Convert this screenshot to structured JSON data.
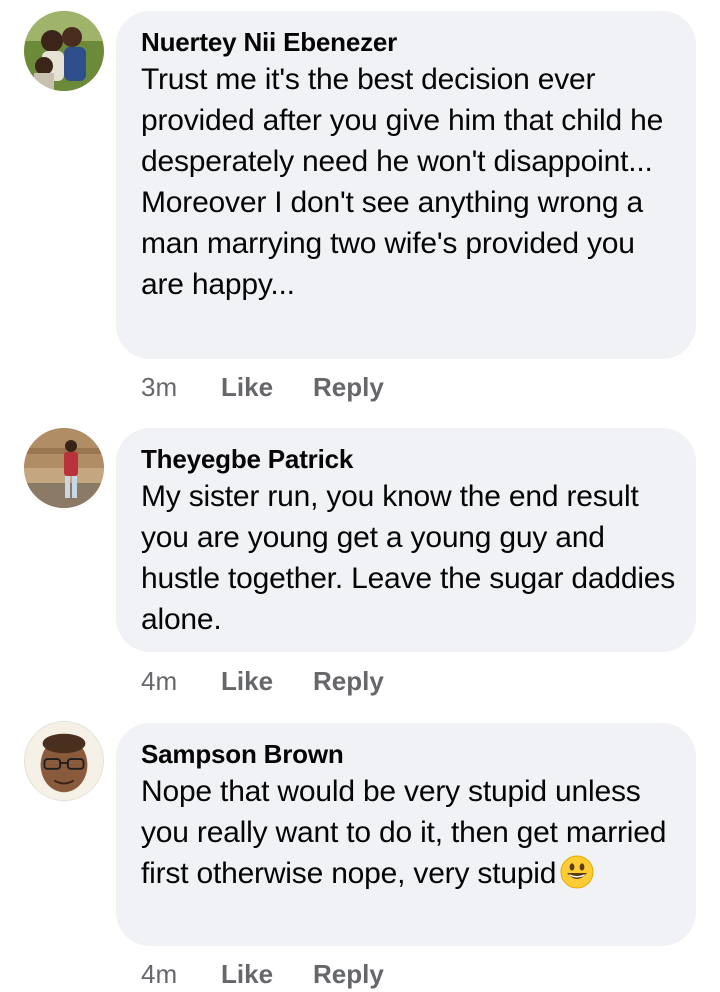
{
  "comments": [
    {
      "author": "Nuertey Nii Ebenezer",
      "text": "Trust me it's the best decision ever provided after you give him that child he desperately need he won't disappoint...\nMoreover I don't see anything wrong a man marrying two wife's provided you are happy...",
      "time": "3m",
      "like_label": "Like",
      "reply_label": "Reply",
      "avatar_icon": "profile-photo-children"
    },
    {
      "author": "Theyegbe Patrick",
      "text": "My sister run, you know the end result you are young get a young guy and hustle together. Leave the sugar daddies alone.",
      "time": "4m",
      "like_label": "Like",
      "reply_label": "Reply",
      "avatar_icon": "profile-photo-person-standing"
    },
    {
      "author": "Sampson Brown",
      "text": "Nope that would be very stupid unless you really want to do it, then get married first  otherwise nope, very stupid",
      "time": "4m",
      "like_label": "Like",
      "reply_label": "Reply",
      "avatar_icon": "profile-photo-man-glasses",
      "trailing_emoji": "grinning-face-emoji"
    }
  ],
  "colors": {
    "bubble_bg": "#f0f2f5",
    "meta_text": "#65676b",
    "emoji_yellow": "#ffcc33"
  }
}
